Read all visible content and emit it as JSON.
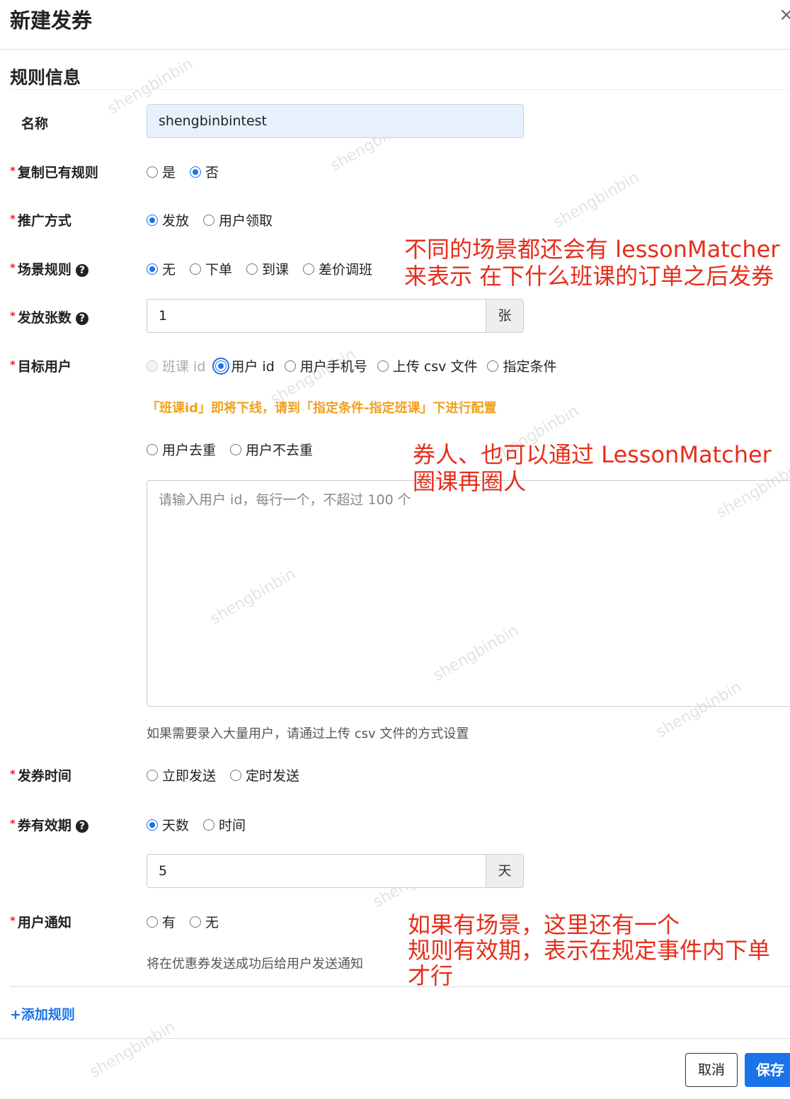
{
  "dialog": {
    "title": "新建发券",
    "close_icon": "×"
  },
  "section": {
    "title": "规则信息"
  },
  "required_mark": "*",
  "fields": {
    "name": {
      "label": "名称",
      "value": "shengbinbintest"
    },
    "copy_rule": {
      "label": "复制已有规则",
      "options": [
        "是",
        "否"
      ],
      "selected": "否"
    },
    "promo_method": {
      "label": "推广方式",
      "options": [
        "发放",
        "用户领取"
      ],
      "selected": "发放"
    },
    "scene_rule": {
      "label": "场景规则",
      "options": [
        "无",
        "下单",
        "到课",
        "差价调班"
      ],
      "selected": "无"
    },
    "issue_count": {
      "label": "发放张数",
      "value": "1",
      "unit": "张"
    },
    "target_user": {
      "label": "目标用户",
      "options": [
        "班课 id",
        "用户 id",
        "用户手机号",
        "上传 csv 文件",
        "指定条件"
      ],
      "selected": "用户 id",
      "disabled": "班课 id",
      "warning": "「班课id」即将下线，请到「指定条件-指定班课」下进行配置",
      "dedupe_options": [
        "用户去重",
        "用户不去重"
      ],
      "textarea_placeholder": "请输入用户 id，每行一个，不超过 100 个",
      "hint": "如果需要录入大量用户，请通过上传 csv 文件的方式设置"
    },
    "issue_time": {
      "label": "发券时间",
      "options": [
        "立即发送",
        "定时发送"
      ]
    },
    "validity": {
      "label": "券有效期",
      "options": [
        "天数",
        "时间"
      ],
      "selected": "天数",
      "value": "5",
      "unit": "天"
    },
    "notify": {
      "label": "用户通知",
      "options": [
        "有",
        "无"
      ],
      "hint": "将在优惠券发送成功后给用户发送通知"
    }
  },
  "help_icon": "?",
  "add_rule": "+添加规则",
  "buttons": {
    "cancel": "取消",
    "save": "保存"
  },
  "annotations": [
    {
      "line1": "不同的场景都还会有 lessonMatcher",
      "line2": "来表示 在下什么班课的订单之后发券"
    },
    {
      "line1": "券人、也可以通过 LessonMatcher",
      "line2": "圈课再圈人"
    },
    {
      "line1": "如果有场景，这里还有一个",
      "line2": "规则有效期，表示在规定事件内下单",
      "line3": "才行"
    }
  ],
  "watermark": "shengbinbin"
}
